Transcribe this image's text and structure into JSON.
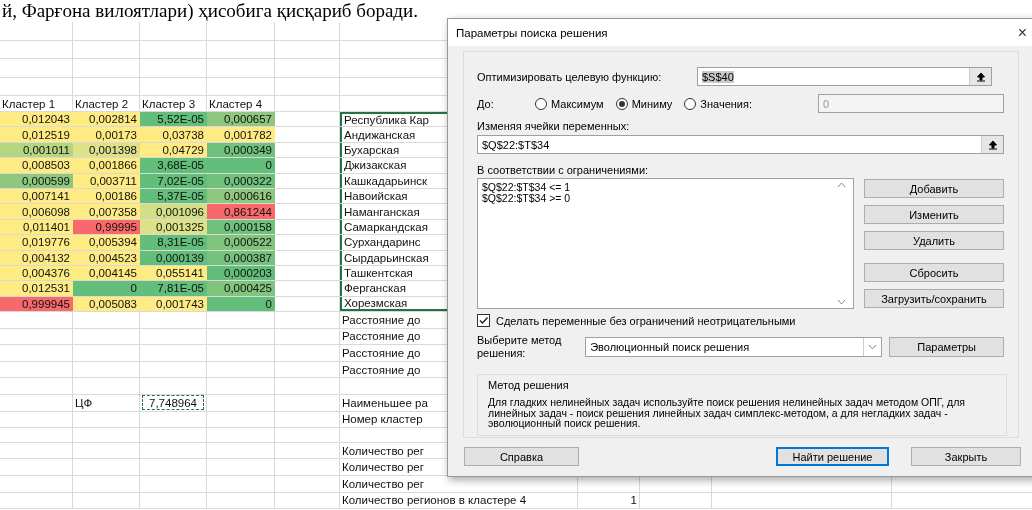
{
  "document_text": "й, Фарғона вилоятлари) ҳисобига қисқариб боради.",
  "cluster_table": {
    "columns": [
      "Кластер 1",
      "Кластер 2",
      "Кластер 3",
      "Кластер 4"
    ],
    "rows": [
      [
        {
          "text": "0,012043",
          "color": "#ffeb84"
        },
        {
          "text": "0,002814",
          "color": "#ffeb84"
        },
        {
          "text": "5,52E-05",
          "color": "#63be7b"
        },
        {
          "text": "0,000657",
          "color": "#8dc87e"
        }
      ],
      [
        {
          "text": "0,012519",
          "color": "#ffeb84"
        },
        {
          "text": "0,00173",
          "color": "#ffeb84"
        },
        {
          "text": "0,03738",
          "color": "#ffeb84"
        },
        {
          "text": "0,001782",
          "color": "#ffeb84"
        }
      ],
      [
        {
          "text": "0,001011",
          "color": "#b5d681"
        },
        {
          "text": "0,001398",
          "color": "#dde289"
        },
        {
          "text": "0,04729",
          "color": "#ffeb84"
        },
        {
          "text": "0,000349",
          "color": "#6fc17c"
        }
      ],
      [
        {
          "text": "0,008503",
          "color": "#ffeb84"
        },
        {
          "text": "0,001866",
          "color": "#ffeb84"
        },
        {
          "text": "3,68E-05",
          "color": "#63be7b"
        },
        {
          "text": "0",
          "color": "#63be7b"
        }
      ],
      [
        {
          "text": "0,000599",
          "color": "#8dc87e"
        },
        {
          "text": "0,003711",
          "color": "#ffeb84"
        },
        {
          "text": "7,02E-05",
          "color": "#63be7b"
        },
        {
          "text": "0,000322",
          "color": "#6fc17c"
        }
      ],
      [
        {
          "text": "0,007141",
          "color": "#ffeb84"
        },
        {
          "text": "0,00186",
          "color": "#ffeb84"
        },
        {
          "text": "5,37E-05",
          "color": "#63be7b"
        },
        {
          "text": "0,000616",
          "color": "#8dc87e"
        }
      ],
      [
        {
          "text": "0,006098",
          "color": "#ffeb84"
        },
        {
          "text": "0,007358",
          "color": "#ffeb84"
        },
        {
          "text": "0,001096",
          "color": "#d2df87"
        },
        {
          "text": "0,861244",
          "color": "#f8696b"
        }
      ],
      [
        {
          "text": "0,011401",
          "color": "#ffeb84"
        },
        {
          "text": "0,99995",
          "color": "#f8696b"
        },
        {
          "text": "0,001325",
          "color": "#dde289"
        },
        {
          "text": "0,000158",
          "color": "#6fc17c"
        }
      ],
      [
        {
          "text": "0,019776",
          "color": "#ffeb84"
        },
        {
          "text": "0,005394",
          "color": "#ffeb84"
        },
        {
          "text": "8,31E-05",
          "color": "#63be7b"
        },
        {
          "text": "0,000522",
          "color": "#80c47d"
        }
      ],
      [
        {
          "text": "0,004132",
          "color": "#ffeb84"
        },
        {
          "text": "0,004523",
          "color": "#ffeb84"
        },
        {
          "text": "0,000139",
          "color": "#63be7b"
        },
        {
          "text": "0,000387",
          "color": "#75c27c"
        }
      ],
      [
        {
          "text": "0,004376",
          "color": "#ffeb84"
        },
        {
          "text": "0,004145",
          "color": "#ffeb84"
        },
        {
          "text": "0,055141",
          "color": "#ffeb84"
        },
        {
          "text": "0,000203",
          "color": "#63be7b"
        }
      ],
      [
        {
          "text": "0,012531",
          "color": "#ffeb84"
        },
        {
          "text": "0",
          "color": "#63be7b"
        },
        {
          "text": "7,81E-05",
          "color": "#63be7b"
        },
        {
          "text": "0,000425",
          "color": "#80c47d"
        }
      ],
      [
        {
          "text": "0,999945",
          "color": "#f8696b"
        },
        {
          "text": "0,005083",
          "color": "#ffeb84"
        },
        {
          "text": "0,001743",
          "color": "#ffeb84"
        },
        {
          "text": "0",
          "color": "#63be7b"
        }
      ]
    ]
  },
  "regions": [
    "Республика Кар",
    "Андижанская",
    "Бухарская",
    "Джизакская",
    "Кашкадарьинск",
    "Навоийская",
    "Наманганская",
    "Самаркандская",
    "Сурхандаринс",
    "Сырдарьинская",
    "Ташкентская",
    "Ферганская",
    "Хорезмская"
  ],
  "distance_rows": [
    "Расстояние до",
    "Расстояние до",
    "Расстояние до",
    "Расстояние до"
  ],
  "objective_cell": {
    "label": "ЦФ",
    "value": "7,748964"
  },
  "result_rows": [
    "Наименьшее ра",
    "Номер кластер"
  ],
  "count_rows": [
    {
      "label": "Количество рег"
    },
    {
      "label": "Количество рег"
    },
    {
      "label": "Количество рег"
    },
    {
      "label": "Количество регионов в кластере 4",
      "value": "1"
    }
  ],
  "dialog": {
    "title": "Параметры поиска решения",
    "close": "×",
    "objective": {
      "label": "Оптимизировать целевую функцию:",
      "value": "$S$40"
    },
    "to": {
      "label": "До:",
      "options": [
        {
          "label": "Максимум",
          "selected": false
        },
        {
          "label": "Миниму",
          "selected": true
        },
        {
          "label": "Значения:",
          "selected": false
        }
      ],
      "placeholder": "0",
      "disabled": true
    },
    "variables": {
      "label": "Изменяя ячейки переменных:",
      "value": "$Q$22:$T$34"
    },
    "constraints": {
      "label": "В соответствии с ограничениями:",
      "items": [
        "$Q$22:$T$34 <= 1",
        "$Q$22:$T$34 >= 0"
      ]
    },
    "constraint_buttons": [
      "Добавить",
      "Изменить",
      "Удалить",
      "Сбросить",
      "Загрузить/сохранить"
    ],
    "nonnegative": {
      "label": "Сделать переменные без ограничений неотрицательными",
      "checked": true
    },
    "method": {
      "label": "Выберите метод решения:",
      "value": "Эволюционный поиск решения",
      "button": "Параметры"
    },
    "description": {
      "title": "Метод решения",
      "text": "Для гладких нелинейных задач используйте поиск решения нелинейных задач методом ОПГ, для линейных задач - поиск решения линейных задач симплекс-методом, а для негладких задач - эволюционный поиск решения."
    },
    "footer_buttons": [
      {
        "label": "Справка",
        "kind": "normal"
      },
      {
        "label": "Найти решение",
        "kind": "default"
      },
      {
        "label": "Закрыть",
        "kind": "normal"
      }
    ]
  }
}
